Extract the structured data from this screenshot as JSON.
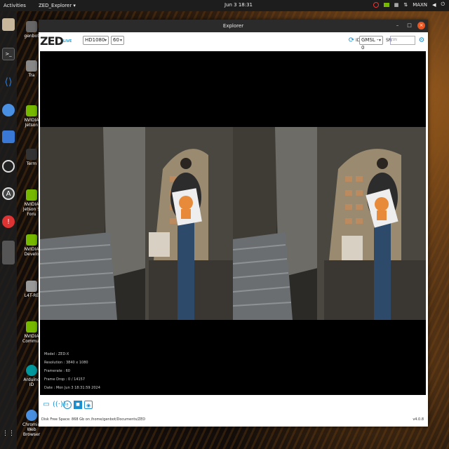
{
  "topbar": {
    "activities": "Activities",
    "app_menu": "ZED_Explorer ▾",
    "clock": "Jun 3  18:31",
    "user": "MAXN"
  },
  "dock": {
    "items": [
      {
        "name": "files",
        "color": "#c9b79c"
      },
      {
        "name": "terminal",
        "color": "#333333"
      },
      {
        "name": "vscode",
        "color": "#2b7bd6"
      },
      {
        "name": "chromium",
        "color": "#4a90e2"
      },
      {
        "name": "screenshot",
        "color": "#3a78d6"
      },
      {
        "name": "obs",
        "color": "#222222"
      },
      {
        "name": "app-store",
        "color": "#444444"
      },
      {
        "name": "help",
        "color": "#d33333"
      },
      {
        "name": "show-apps",
        "color": "#555555"
      }
    ]
  },
  "desktop": {
    "icons": [
      {
        "label": "genbot"
      },
      {
        "label": "Tra"
      },
      {
        "label": "NVIDIA Jetson"
      },
      {
        "label": "Term"
      },
      {
        "label": "NVIDIA Jetson S Foru"
      },
      {
        "label": "NVIDIA Develo"
      },
      {
        "label": "L4T-RE"
      },
      {
        "label": "NVIDIA Commun"
      },
      {
        "label": "Arduino ID"
      },
      {
        "label": "Chromium Web Browser"
      }
    ]
  },
  "window": {
    "title": "Explorer",
    "logo": "ZED",
    "live_label": "LIVE",
    "resolution_select": "HD1080",
    "fps_select": "60",
    "id_label": "ID",
    "camera_select": "GMSL - 0",
    "sn_label": "SN",
    "sn_placeholder": "SN",
    "info": {
      "model": "Model : ZED-X",
      "resolution": "Resolution : 3840 x 1080",
      "framerate": "Framerate : 60",
      "frame_drop": "Frame Drop : 0 / 14157",
      "date": "Date : Mon Jun 3 18:31:59 2024"
    },
    "status": "Disk Free Space: 868 Gb  on /home/genbot/Documents/ZED",
    "version": "v4.0.8"
  },
  "colors": {
    "accent": "#1a8fd0",
    "close": "#e95420"
  }
}
